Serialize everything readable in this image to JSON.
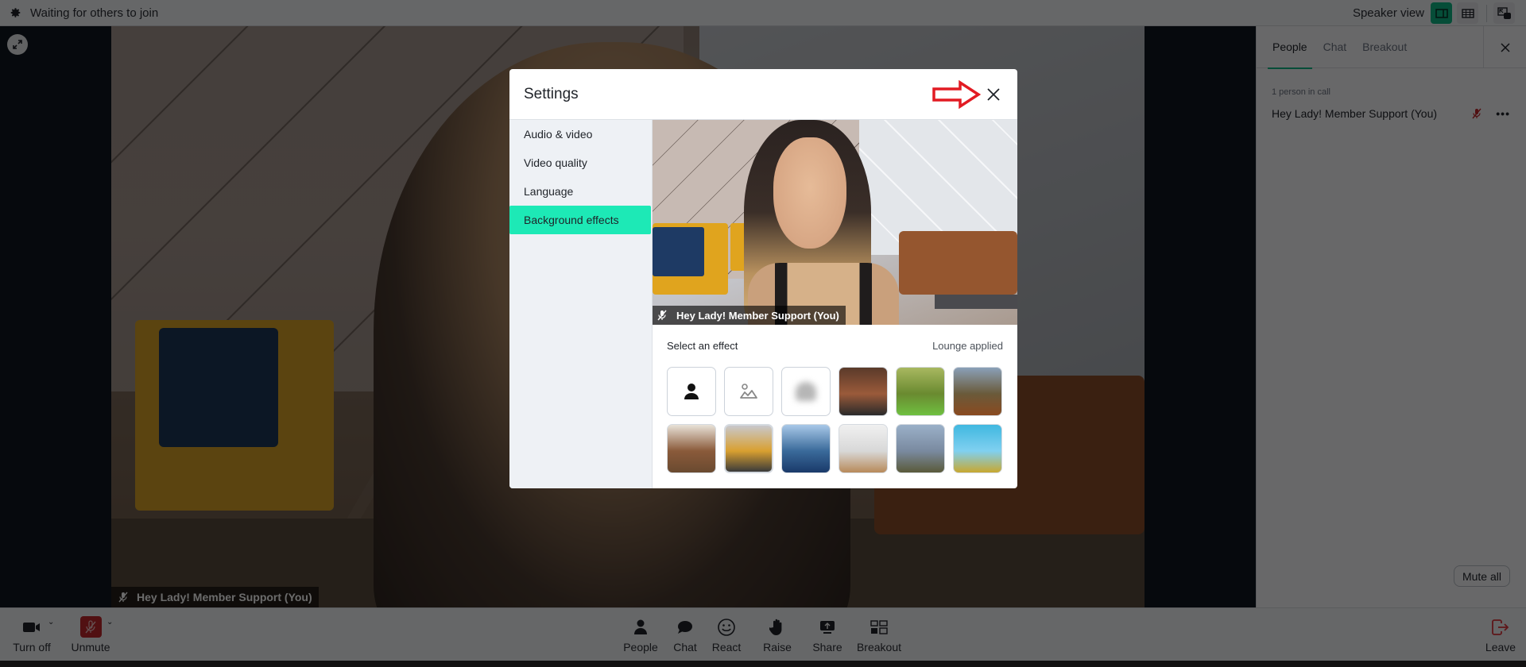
{
  "topbar": {
    "status": "Waiting for others to join",
    "view_label": "Speaker view",
    "icons": [
      "gear-icon",
      "speaker-view-icon",
      "grid-view-icon",
      "picture-in-picture-icon"
    ]
  },
  "stage": {
    "participant_name": "Hey Lady! Member Support (You)",
    "expand_icon": "expand-icon"
  },
  "panel": {
    "tabs": [
      {
        "label": "People",
        "active": true
      },
      {
        "label": "Chat",
        "active": false
      },
      {
        "label": "Breakout",
        "active": false
      }
    ],
    "count": "1 person in call",
    "participants": [
      {
        "name": "Hey Lady! Member Support (You)",
        "muted": true
      }
    ],
    "mute_all": "Mute all"
  },
  "toolbar": {
    "camera": "Turn off",
    "mic": "Unmute",
    "people": "People",
    "chat": "Chat",
    "react": "React",
    "raise": "Raise",
    "share": "Share",
    "breakout": "Breakout",
    "leave": "Leave"
  },
  "modal": {
    "title": "Settings",
    "menu": [
      {
        "label": "Audio & video",
        "active": false
      },
      {
        "label": "Video quality",
        "active": false
      },
      {
        "label": "Language",
        "active": false
      },
      {
        "label": "Background effects",
        "active": true
      }
    ],
    "preview_name": "Hey Lady! Member Support (You)",
    "effects_label": "Select an effect",
    "applied_label": "Lounge applied",
    "effects": [
      {
        "name": "none",
        "kind": "icon"
      },
      {
        "name": "blur-light",
        "kind": "icon"
      },
      {
        "name": "blur-strong",
        "kind": "icon"
      },
      {
        "name": "brick-cafe",
        "kind": "image",
        "colors": [
          "#5a3a2a",
          "#9a5a3a",
          "#2a2a2a"
        ]
      },
      {
        "name": "tree-alley",
        "kind": "image",
        "colors": [
          "#a8b860",
          "#6a8a30",
          "#6fc040"
        ]
      },
      {
        "name": "autumn-mountains",
        "kind": "image",
        "colors": [
          "#8aa0b8",
          "#6a5a3a",
          "#8a4a20"
        ]
      },
      {
        "name": "library",
        "kind": "image",
        "colors": [
          "#e8e2d8",
          "#8a5a3a",
          "#6a4a30"
        ]
      },
      {
        "name": "lounge",
        "kind": "image",
        "selected": true,
        "colors": [
          "#c8c8cc",
          "#d9a030",
          "#3a3a3a"
        ]
      },
      {
        "name": "ocean",
        "kind": "image",
        "colors": [
          "#a8c8e8",
          "#3a6a9a",
          "#1a3a6a"
        ]
      },
      {
        "name": "bright-hallway",
        "kind": "image",
        "colors": [
          "#f0f0f0",
          "#d8d8d8",
          "#b88a5a"
        ]
      },
      {
        "name": "palm-sky",
        "kind": "image",
        "colors": [
          "#9ab0c8",
          "#7a8aa0",
          "#5a5a3a"
        ]
      },
      {
        "name": "roller-coaster",
        "kind": "image",
        "colors": [
          "#40b8e0",
          "#80d0f0",
          "#c8a830"
        ]
      }
    ],
    "annotation": "red-arrow-pointing-to-close"
  }
}
